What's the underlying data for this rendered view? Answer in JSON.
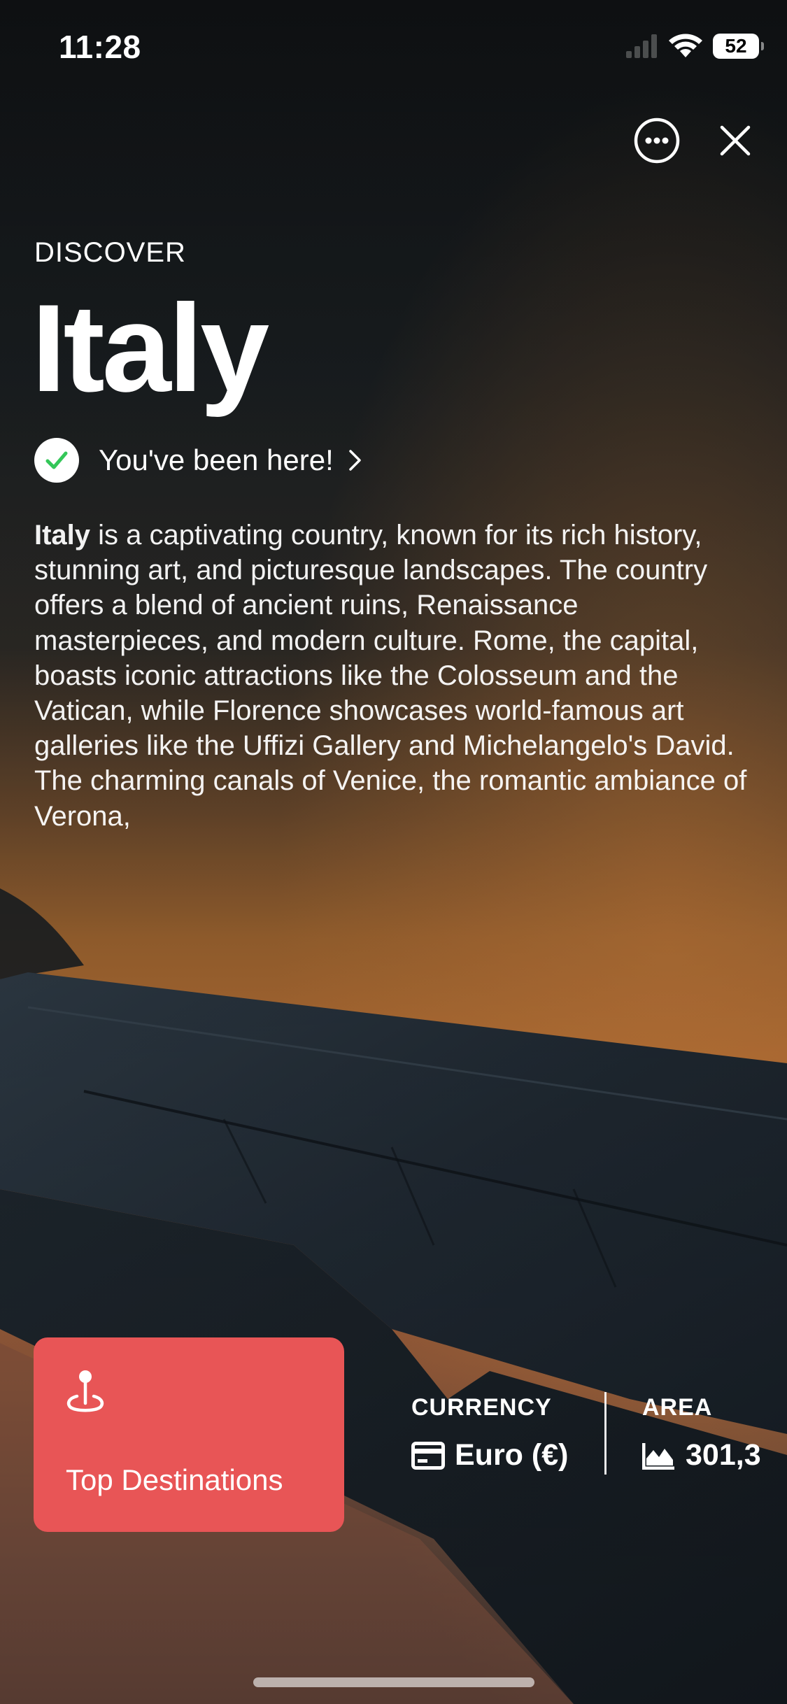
{
  "status_bar": {
    "time": "11:28",
    "battery": "52"
  },
  "controls": {
    "more_icon": "ellipsis-circle-icon",
    "close_icon": "close-icon"
  },
  "header": {
    "eyebrow": "DISCOVER",
    "title": "Italy"
  },
  "visited": {
    "label": "You've been here!",
    "icon": "check-circle-icon"
  },
  "description": {
    "lead": "Italy",
    "text": " is a captivating country, known for its rich history, stunning art, and picturesque landscapes. The country offers a blend of ancient ruins, Renaissance masterpieces, and modern culture. Rome, the capital, boasts iconic attractions like the Colosseum and the Vatican, while Florence showcases world-famous art galleries like the Uffizi Gallery and Michelangelo's David. The charming canals of Venice, the romantic ambiance of Verona,"
  },
  "top_destinations": {
    "label": "Top Destinations",
    "icon": "map-pin-icon",
    "color": "#e85556"
  },
  "stats": {
    "currency": {
      "label": "CURRENCY",
      "value": "Euro (€)",
      "icon": "credit-card-icon"
    },
    "area": {
      "label": "AREA",
      "value": "301,3",
      "icon": "mountain-chart-icon"
    }
  }
}
